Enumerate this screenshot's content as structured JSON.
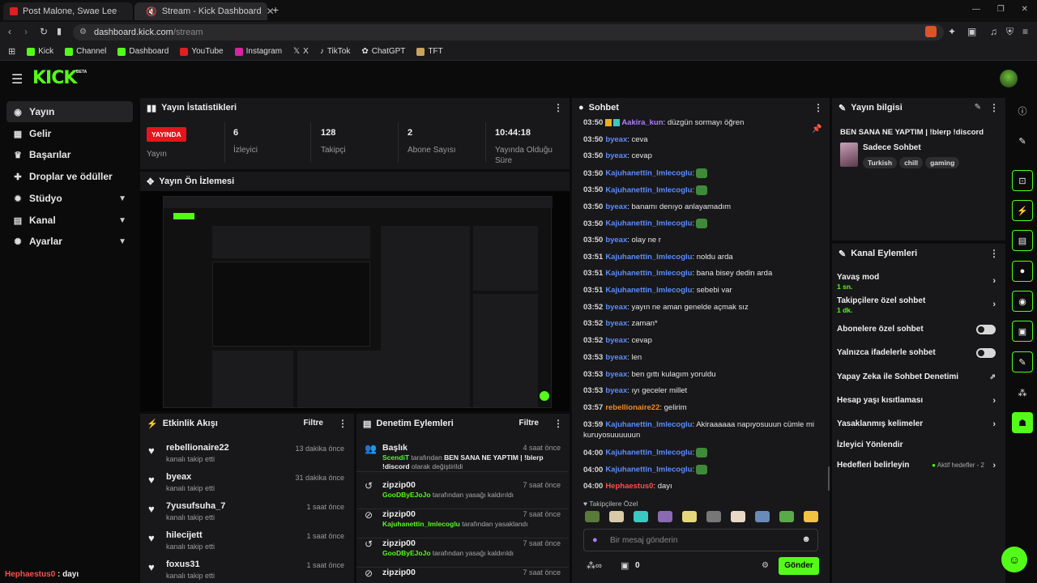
{
  "browser": {
    "tabs": [
      {
        "title": "Post Malone, Swae Lee - Sunflower (",
        "favicon_color": "#e02020"
      },
      {
        "title": "Stream - Kick Dashboard",
        "favicon_color": "#53fc18"
      }
    ],
    "new_tab": "+",
    "url_host": "dashboard.kick.com",
    "url_path": "/stream",
    "bookmarks": [
      {
        "label": "Kick",
        "color": "#53fc18"
      },
      {
        "label": "Channel",
        "color": "#53fc18"
      },
      {
        "label": "Dashboard",
        "color": "#53fc18"
      },
      {
        "label": "YouTube",
        "color": "#e02020"
      },
      {
        "label": "Instagram",
        "color": "#d6249f"
      },
      {
        "label": "X",
        "color": "#dddddd"
      },
      {
        "label": "TikTok",
        "color": "#dddddd"
      },
      {
        "label": "ChatGPT",
        "color": "#dddddd"
      },
      {
        "label": "TFT",
        "color": "#c9a35a"
      }
    ]
  },
  "app": {
    "logo": "KICK",
    "logo_badge": "BETA",
    "accent": "#53fc18"
  },
  "sidebar": {
    "items": [
      {
        "label": "Yayın",
        "icon": "broadcast-icon",
        "glyph": "((·))",
        "active": true
      },
      {
        "label": "Gelir",
        "icon": "revenue-icon",
        "glyph": "▦"
      },
      {
        "label": "Başarılar",
        "icon": "trophy-icon",
        "glyph": "🏆"
      },
      {
        "label": "Droplar ve ödüller",
        "icon": "gift-icon",
        "glyph": "🎁"
      },
      {
        "label": "Stüdyo",
        "icon": "studio-icon",
        "glyph": "⚙",
        "expandable": true
      },
      {
        "label": "Kanal",
        "icon": "channel-icon",
        "glyph": "▤",
        "expandable": true
      },
      {
        "label": "Ayarlar",
        "icon": "settings-icon",
        "glyph": "✺",
        "expandable": true
      }
    ]
  },
  "stats": {
    "title": "Yayın İstatistikleri",
    "live_badge": "YAYINDA",
    "live_label": "Yayın",
    "viewers_value": "6",
    "viewers_label": "İzleyici",
    "followers_value": "128",
    "followers_label": "Takipçi",
    "subs_value": "2",
    "subs_label": "Abone Sayısı",
    "uptime_value": "10:44:18",
    "uptime_label": "Yayında Olduğu Süre"
  },
  "preview": {
    "title": "Yayın Ön İzlemesi"
  },
  "activity": {
    "title": "Etkinlik Akışı",
    "filter": "Filtre",
    "items": [
      {
        "user": "rebellionaire22",
        "action": "kanalı takip etti",
        "time": "13 dakika önce"
      },
      {
        "user": "byeax",
        "action": "kanalı takip etti",
        "time": "31 dakika önce"
      },
      {
        "user": "7yusufsuha_7",
        "action": "kanalı takip etti",
        "time": "1 saat önce"
      },
      {
        "user": "hilecijett",
        "action": "kanalı takip etti",
        "time": "1 saat önce"
      },
      {
        "user": "foxus31",
        "action": "kanalı takip etti",
        "time": "1 saat önce"
      }
    ]
  },
  "moderation": {
    "title": "Denetim Eylemleri",
    "filter": "Filtre",
    "items": [
      {
        "title": "Başlık",
        "time": "4 saat önce",
        "actor": "ScendiT",
        "text1": " tarafından ",
        "bold": "BEN SANA NE YAPTIM | !blerp !discord",
        "text2": " olarak değiştirildi",
        "icon": "title-change-icon",
        "glyph": "👥"
      },
      {
        "title": "zipzip00",
        "time": "7 saat önce",
        "actor": "GooDByEJoJo",
        "text1": " tarafından yasağı kaldırıldı",
        "icon": "unban-icon",
        "glyph": "↺"
      },
      {
        "title": "zipzip00",
        "time": "7 saat önce",
        "actor": "Kajuhanettin_Imlecoglu",
        "text1": " tarafından yasaklandı",
        "icon": "ban-icon",
        "glyph": "⊘"
      },
      {
        "title": "zipzip00",
        "time": "7 saat önce",
        "actor": "GooDByEJoJo",
        "text1": " tarafından yasağı kaldırıldı",
        "icon": "unban-icon",
        "glyph": "↺"
      },
      {
        "title": "zipzip00",
        "time": "7 saat önce",
        "actor": "",
        "text1": "",
        "icon": "ban-icon",
        "glyph": "⊘"
      }
    ]
  },
  "chat": {
    "title": "Sohbet",
    "followers_only": "Takipçilere Özel",
    "placeholder": "Bir mesaj gönderin",
    "send": "Gönder",
    "count": "0",
    "messages": [
      {
        "time": "03:50",
        "user": "Aakira_kun",
        "color": "#b07cff",
        "text": ": düzgün sormayı öğren",
        "badges": true
      },
      {
        "time": "03:50",
        "user": "byeax",
        "color": "#5b8cff",
        "text": ": ceva"
      },
      {
        "time": "03:50",
        "user": "byeax",
        "color": "#5b8cff",
        "text": ": cevap"
      },
      {
        "time": "03:50",
        "user": "Kajuhanettin_Imlecoglu",
        "color": "#5b8cff",
        "text": ":",
        "emote": true
      },
      {
        "time": "03:50",
        "user": "Kajuhanettin_Imlecoglu",
        "color": "#5b8cff",
        "text": ":",
        "emote": true
      },
      {
        "time": "03:50",
        "user": "byeax",
        "color": "#5b8cff",
        "text": ": banamı denıyo anlayamadım"
      },
      {
        "time": "03:50",
        "user": "Kajuhanettin_Imlecoglu",
        "color": "#5b8cff",
        "text": ":",
        "emote": true
      },
      {
        "time": "03:50",
        "user": "byeax",
        "color": "#5b8cff",
        "text": ": olay ne r"
      },
      {
        "time": "03:51",
        "user": "Kajuhanettin_Imlecoglu",
        "color": "#5b8cff",
        "text": ": noldu arda"
      },
      {
        "time": "03:51",
        "user": "Kajuhanettin_Imlecoglu",
        "color": "#5b8cff",
        "text": ": bana bisey dedin arda"
      },
      {
        "time": "03:51",
        "user": "Kajuhanettin_Imlecoglu",
        "color": "#5b8cff",
        "text": ": sebebi var"
      },
      {
        "time": "03:52",
        "user": "byeax",
        "color": "#5b8cff",
        "text": ": yayın ne aman genelde açmak sız"
      },
      {
        "time": "03:52",
        "user": "byeax",
        "color": "#5b8cff",
        "text": ": zaman*"
      },
      {
        "time": "03:52",
        "user": "byeax",
        "color": "#5b8cff",
        "text": ": cevap"
      },
      {
        "time": "03:53",
        "user": "byeax",
        "color": "#5b8cff",
        "text": ": len"
      },
      {
        "time": "03:53",
        "user": "byeax",
        "color": "#5b8cff",
        "text": ": ben gıttı kulagım yoruldu"
      },
      {
        "time": "03:53",
        "user": "byeax",
        "color": "#5b8cff",
        "text": ": ıyı geceler millet"
      },
      {
        "time": "03:57",
        "user": "rebellionaire22",
        "color": "#f08a24",
        "text": ": gelirim"
      },
      {
        "time": "03:59",
        "user": "Kajuhanettin_Imlecoglu",
        "color": "#5b8cff",
        "text": ": Akiraaaaaa napıyosuuun cümle mi",
        "cont": "kuruyosuuuuuun"
      },
      {
        "time": "04:00",
        "user": "Kajuhanettin_Imlecoglu",
        "color": "#5b8cff",
        "text": ":",
        "emote": true
      },
      {
        "time": "04:00",
        "user": "Kajuhanettin_Imlecoglu",
        "color": "#5b8cff",
        "text": ":",
        "emote": true
      },
      {
        "time": "04:00",
        "user": "Hephaestus0",
        "color": "#ff4d4d",
        "text": ": dayı"
      }
    ]
  },
  "stream_info": {
    "title": "Yayın bilgisi",
    "stream_title": "BEN SANA NE YAPTIM | !blerp !discord",
    "category": "Sadece Sohbet",
    "tags": [
      "Turkish",
      "chill",
      "gaming"
    ]
  },
  "channel_actions": {
    "title": "Kanal Eylemleri",
    "slow_mode": "Yavaş mod",
    "slow_mode_value": "1 sn.",
    "followers_only": "Takipçilere özel sohbet",
    "followers_only_value": "1 dk.",
    "subs_only": "Abonelere özel sohbet",
    "emotes_only": "Yalnızca ifadelerle sohbet",
    "ai_moderation": "Yapay Zeka ile Sohbet Denetimi",
    "account_age": "Hesap yaşı kısıtlaması",
    "banned_words": "Yasaklanmış kelimeler",
    "redirect": "İzleyici Yönlendir",
    "goals": "Hedefleri belirleyin",
    "goals_status": "Aktif hedefler - 2"
  },
  "footer_chat": {
    "user": "Hephaestus0",
    "text": " : dayı"
  }
}
